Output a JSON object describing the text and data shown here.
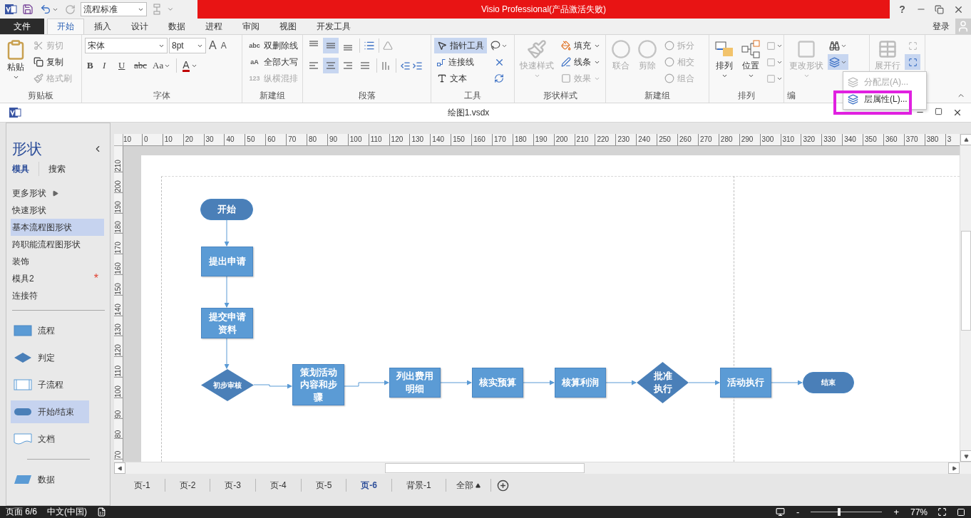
{
  "quick_access": {
    "style_combo": "流程标准"
  },
  "title": "Visio Professional(产品激活失败)",
  "help": "?",
  "tabs": [
    {
      "label": "文件",
      "kind": "file",
      "selected": false
    },
    {
      "label": "开始",
      "kind": "tab",
      "selected": true
    },
    {
      "label": "插入",
      "kind": "tab",
      "selected": false
    },
    {
      "label": "设计",
      "kind": "tab",
      "selected": false
    },
    {
      "label": "数据",
      "kind": "tab",
      "selected": false
    },
    {
      "label": "进程",
      "kind": "tab",
      "selected": false
    },
    {
      "label": "审阅",
      "kind": "tab",
      "selected": false
    },
    {
      "label": "视图",
      "kind": "tab",
      "selected": false
    },
    {
      "label": "开发工具",
      "kind": "tab",
      "selected": false
    }
  ],
  "account": "登录",
  "ribbon": {
    "clipboard": {
      "label": "剪贴板",
      "paste": "粘贴",
      "items": [
        {
          "label": "剪切",
          "disabled": true
        },
        {
          "label": "复制",
          "disabled": false
        },
        {
          "label": "格式刷",
          "disabled": true
        }
      ]
    },
    "font": {
      "label": "字体",
      "family": "宋体",
      "size": "8pt",
      "grow": "A",
      "shrink": "A",
      "format_buttons": [
        "B",
        "I",
        "U",
        "abc",
        "Aa"
      ],
      "color_button": "A"
    },
    "new_group_1": {
      "label": "新建组",
      "items": [
        {
          "icon_text": "abc",
          "label": "双删除线",
          "disabled": false
        },
        {
          "icon_text": "aA",
          "label": "全部大写",
          "disabled": false
        },
        {
          "icon_text": "123",
          "label": "纵横混排",
          "disabled": true
        }
      ]
    },
    "paragraph": {
      "label": "段落",
      "vertical_align": [
        {
          "selected": false
        },
        {
          "selected": true
        },
        {
          "selected": false
        }
      ],
      "horizontal_align": [
        {
          "selected": false
        },
        {
          "selected": true
        },
        {
          "selected": false
        },
        {
          "selected": false
        }
      ]
    },
    "tools": {
      "label": "工具",
      "items": [
        {
          "label": "指针工具",
          "selected": true
        },
        {
          "label": "连接线",
          "selected": false
        },
        {
          "label": "文本",
          "selected": false
        }
      ]
    },
    "shape_styles": {
      "label": "形状样式",
      "quick_styles": {
        "label": "快速样式",
        "disabled": true
      },
      "items": [
        {
          "label": "填充",
          "disabled": false
        },
        {
          "label": "线条",
          "disabled": false
        },
        {
          "label": "效果",
          "disabled": true
        }
      ]
    },
    "new_group_2": {
      "label": "新建组",
      "large": [
        {
          "label": "联合",
          "disabled": true
        },
        {
          "label": "剪除",
          "disabled": true
        }
      ],
      "items": [
        {
          "label": "拆分",
          "disabled": true
        },
        {
          "label": "相交",
          "disabled": true
        },
        {
          "label": "组合",
          "disabled": true
        }
      ]
    },
    "arrange": {
      "label": "排列",
      "large": [
        {
          "label": "排列"
        },
        {
          "label": "位置"
        }
      ]
    },
    "editing": {
      "label": "编",
      "change_shape": {
        "label": "更改形状",
        "disabled": true
      },
      "layers_selected": true
    },
    "expand": {
      "label": "展开行",
      "disabled": true
    }
  },
  "dropdown_menu": [
    {
      "label": "分配层(A)...",
      "disabled": true,
      "highlighted": false
    },
    {
      "label": "层属性(L)...",
      "disabled": false,
      "highlighted": true
    }
  ],
  "document": {
    "title": "绘图1.vsdx"
  },
  "shapes_panel": {
    "title": "形状",
    "tabs": [
      {
        "label": "模具",
        "selected": true
      },
      {
        "label": "搜索",
        "selected": false
      }
    ],
    "stencils": [
      {
        "label": "更多形状",
        "kind": "submenu",
        "selected": false
      },
      {
        "label": "快速形状",
        "kind": "plain",
        "selected": false
      },
      {
        "label": "基本流程图形状",
        "kind": "plain",
        "selected": true
      },
      {
        "label": "跨职能流程图形状",
        "kind": "plain",
        "selected": false
      },
      {
        "label": "装饰",
        "kind": "plain",
        "selected": false
      },
      {
        "label": "模具2",
        "kind": "plain",
        "selected": false,
        "marker": "*"
      },
      {
        "label": "连接符",
        "kind": "plain",
        "selected": false
      }
    ],
    "shapes": [
      {
        "label": "流程",
        "kind": "process",
        "selected": false
      },
      {
        "label": "判定",
        "kind": "decision",
        "selected": false
      },
      {
        "label": "子流程",
        "kind": "subprocess",
        "selected": false
      },
      {
        "label": "开始/结束",
        "kind": "terminator",
        "selected": true
      },
      {
        "label": "文档",
        "kind": "document",
        "selected": false
      },
      {
        "label": "数据",
        "kind": "data",
        "selected": false
      }
    ]
  },
  "rulers": {
    "horizontal": [
      "10",
      "0",
      "10",
      "20",
      "30",
      "40",
      "50",
      "60",
      "70",
      "80",
      "90",
      "100",
      "110",
      "120",
      "130",
      "140",
      "150",
      "160",
      "170",
      "180",
      "190",
      "200",
      "210",
      "220",
      "230",
      "240",
      "250",
      "260",
      "270",
      "280",
      "290",
      "300",
      "310",
      "320",
      "330",
      "340",
      "350",
      "360",
      "370",
      "380",
      "3"
    ],
    "vertical": [
      "210",
      "200",
      "190",
      "180",
      "170",
      "160",
      "150",
      "140",
      "130",
      "120",
      "110",
      "100",
      "90",
      "80",
      "70"
    ]
  },
  "flowchart": {
    "nodes": [
      {
        "kind": "terminator",
        "label": "开始",
        "small": false
      },
      {
        "kind": "process",
        "label": "提出申请",
        "small": false
      },
      {
        "kind": "process",
        "label": "提交申请资料",
        "small": false
      },
      {
        "kind": "decision",
        "label": "初步审核",
        "small": true
      },
      {
        "kind": "process",
        "label": "策划活动内容和步骤",
        "small": false
      },
      {
        "kind": "process",
        "label": "列出费用明细",
        "small": false
      },
      {
        "kind": "process",
        "label": "核实预算",
        "small": false
      },
      {
        "kind": "process",
        "label": "核算利润",
        "small": false
      },
      {
        "kind": "decision",
        "label": "批准执行",
        "small": false
      },
      {
        "kind": "process",
        "label": "活动执行",
        "small": false
      },
      {
        "kind": "terminator",
        "label": "结束",
        "small": true
      }
    ]
  },
  "page_tabs": [
    {
      "label": "页-1",
      "selected": false
    },
    {
      "label": "页-2",
      "selected": false
    },
    {
      "label": "页-3",
      "selected": false
    },
    {
      "label": "页-4",
      "selected": false
    },
    {
      "label": "页-5",
      "selected": false
    },
    {
      "label": "页-6",
      "selected": true
    },
    {
      "label": "背景-1",
      "selected": false
    }
  ],
  "all_pages": "全部",
  "status_bar": {
    "page": "页面 6/6",
    "language": "中文(中国)",
    "zoom": {
      "minus": "-",
      "plus": "+",
      "level": 0.4,
      "reading": "77%"
    }
  }
}
